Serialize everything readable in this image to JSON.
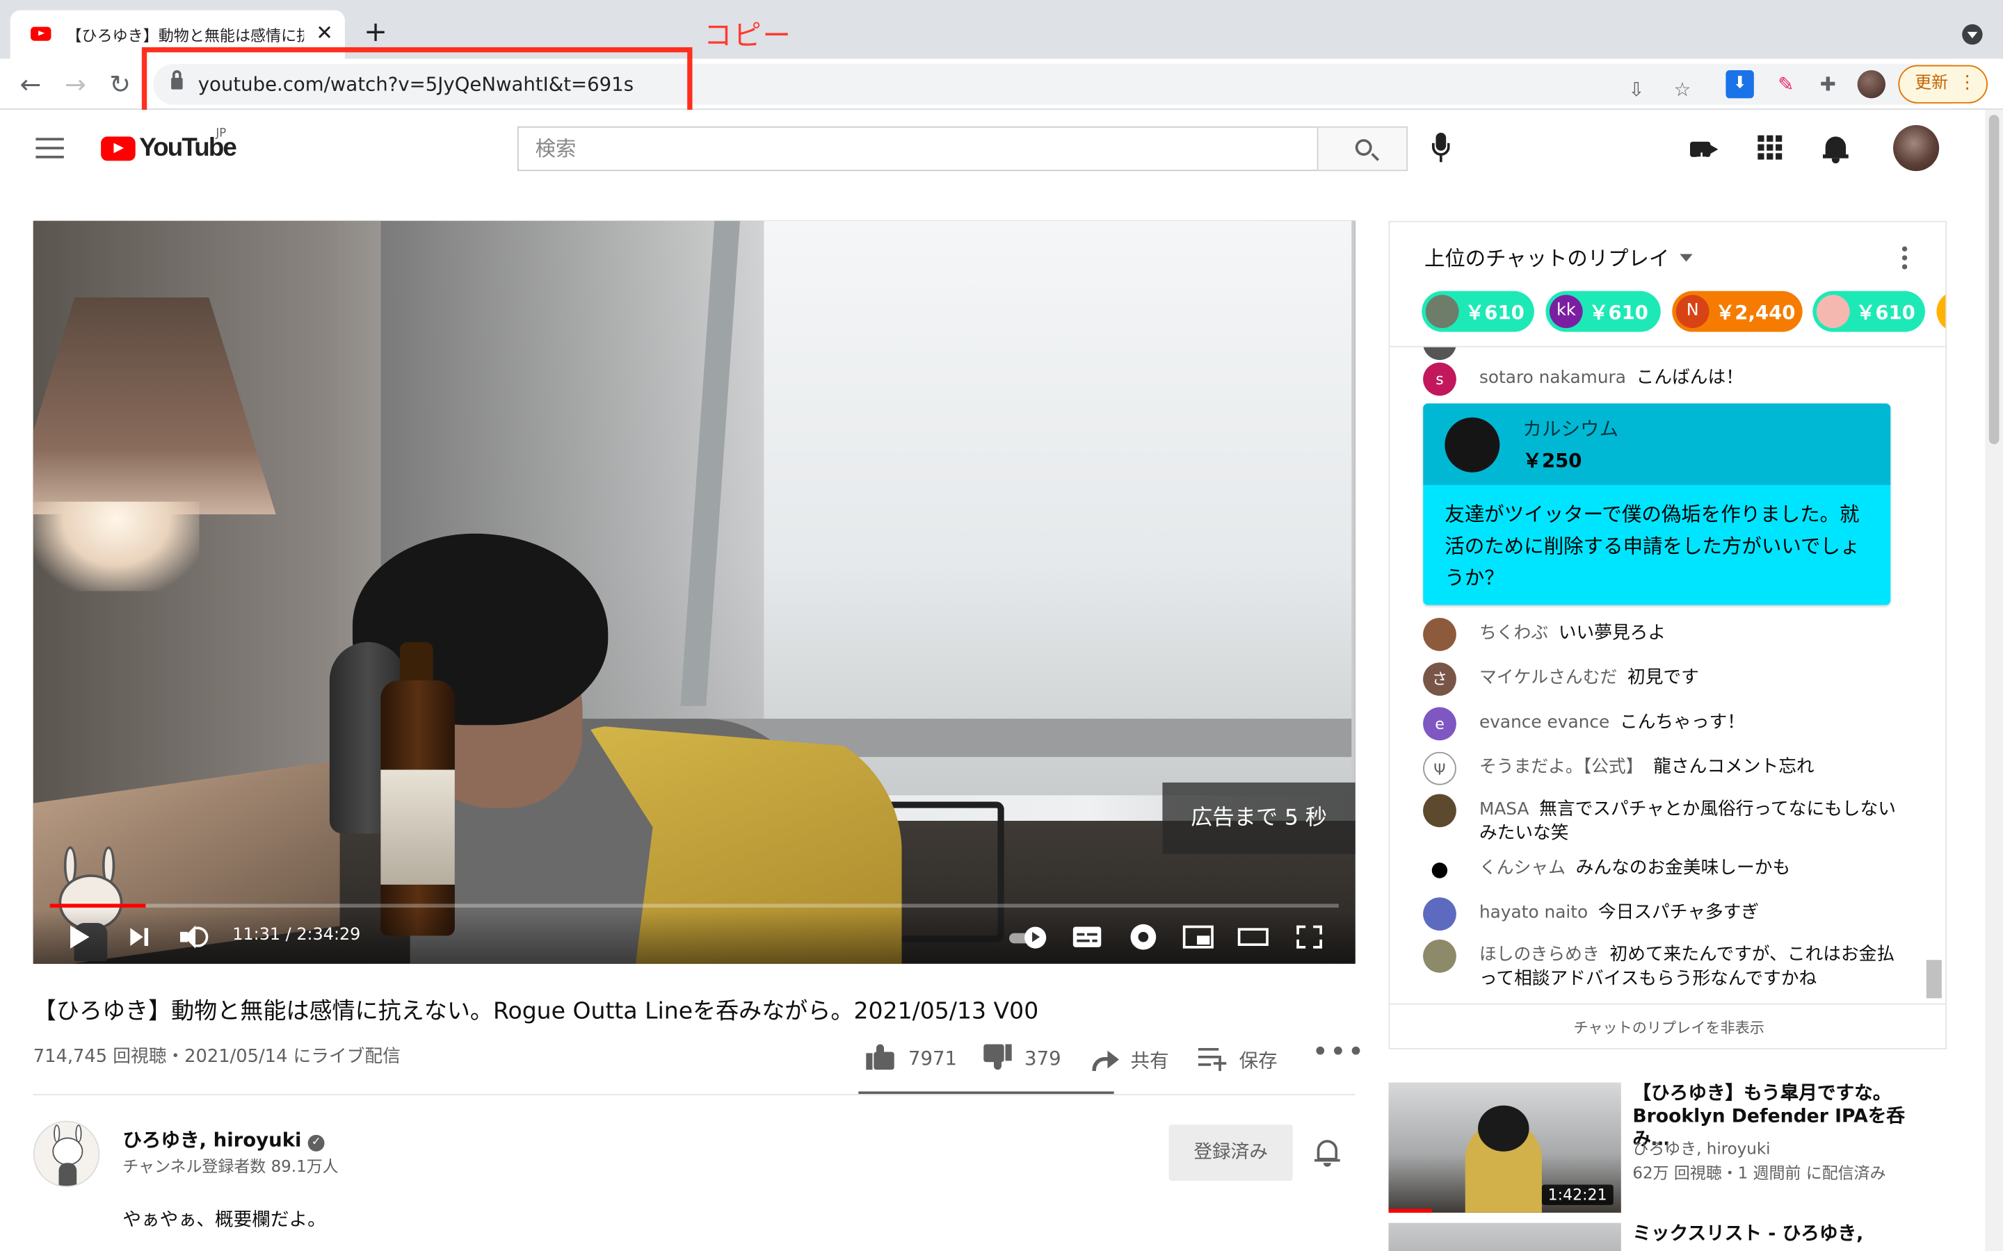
{
  "browser": {
    "tab_title": "【ひろゆき】動物と無能は感情に抗",
    "url": "youtube.com/watch?v=5JyQeNwahtI&t=691s",
    "update_label": "更新"
  },
  "annotation": {
    "copy_label": "コピー",
    "highlight_color": "#ff2e1f"
  },
  "header": {
    "logo_text": "YouTube",
    "region": "JP",
    "search_placeholder": "検索"
  },
  "player": {
    "ad_countdown": "広告まで 5 秒",
    "current_time": "11:31",
    "duration": "2:34:29",
    "time_display": "11:31 / 2:34:29",
    "progress_fraction": 0.0747
  },
  "video": {
    "title": "【ひろゆき】動物と無能は感情に抗えない。Rogue Outta Lineを呑みながら。2021/05/13 V00",
    "meta": "714,745 回視聴・2021/05/14 にライブ配信",
    "like_count": "7971",
    "dislike_count": "379",
    "share_label": "共有",
    "save_label": "保存"
  },
  "channel": {
    "name": "ひろゆき, hiroyuki",
    "subscribers": "チャンネル登録者数 89.1万人",
    "subscribed_label": "登録済み",
    "description": "やぁやぁ、概要欄だよ。"
  },
  "chat": {
    "title": "上位のチャットのリプレイ",
    "tickers": [
      {
        "avatar": "",
        "amount": "￥610",
        "color": "#1de9b6",
        "avatar_color": "#6d7d6a"
      },
      {
        "avatar": "kk",
        "amount": "￥610",
        "color": "#1de9b6",
        "avatar_color": "#7b1fa2"
      },
      {
        "avatar": "N",
        "amount": "￥2,440",
        "color": "#f57c00",
        "avatar_color": "#d84315"
      },
      {
        "avatar": "",
        "amount": "￥610",
        "color": "#1de9b6",
        "avatar_color": "#f4b8b0"
      }
    ],
    "messages": [
      {
        "avatar": "s",
        "avatar_color": "#c2185b",
        "author": "sotaro nakamura",
        "text": "こんばんは！"
      },
      {
        "avatar": "",
        "avatar_color": "#8d5a3b",
        "author": "ちくわぶ",
        "text": "いい夢見ろよ"
      },
      {
        "avatar": "さ",
        "avatar_color": "#795548",
        "author": "マイケルさんむだ",
        "text": "初見です"
      },
      {
        "avatar": "e",
        "avatar_color": "#7e57c2",
        "author": "evance evance",
        "text": "こんちゃっす！"
      },
      {
        "avatar": "",
        "avatar_color": "#ffffff",
        "author": "そうまだよ。【公式】",
        "text": "龍さんコメント忘れ"
      },
      {
        "avatar": "",
        "avatar_color": "#5d4a2e",
        "author": "MASA",
        "text": "無言でスパチャとか風俗行ってなにもしないみたいな笑"
      },
      {
        "avatar": "",
        "avatar_color": "#ffffff",
        "author": "くんシャム",
        "text": "みんなのお金美味しーかも"
      },
      {
        "avatar": "",
        "avatar_color": "#5c6bc0",
        "author": "hayato naito",
        "text": "今日スパチャ多すぎ"
      },
      {
        "avatar": "",
        "avatar_color": "#8d8a6a",
        "author": "ほしのきらめき",
        "text": "初めて来たんですが、これはお金払って相談アドバイスもらう形なんですかね"
      }
    ],
    "superchat": {
      "name": "カルシウム",
      "amount": "￥250",
      "text": "友達がツイッターで僕の偽垢を作りました。就活のために削除する申請をした方がいいでしょうか？"
    },
    "hide_label": "チャットのリプレイを非表示"
  },
  "recommendations": [
    {
      "title": "【ひろゆき】もう皐月ですな。Brooklyn Defender IPAを呑み…",
      "channel": "ひろゆき, hiroyuki",
      "meta": "62万 回視聴・1 週間前 に配信済み",
      "duration": "1:42:21"
    },
    {
      "title": "ミックスリスト - ひろゆき,",
      "channel": "",
      "meta": "",
      "duration": ""
    }
  ]
}
